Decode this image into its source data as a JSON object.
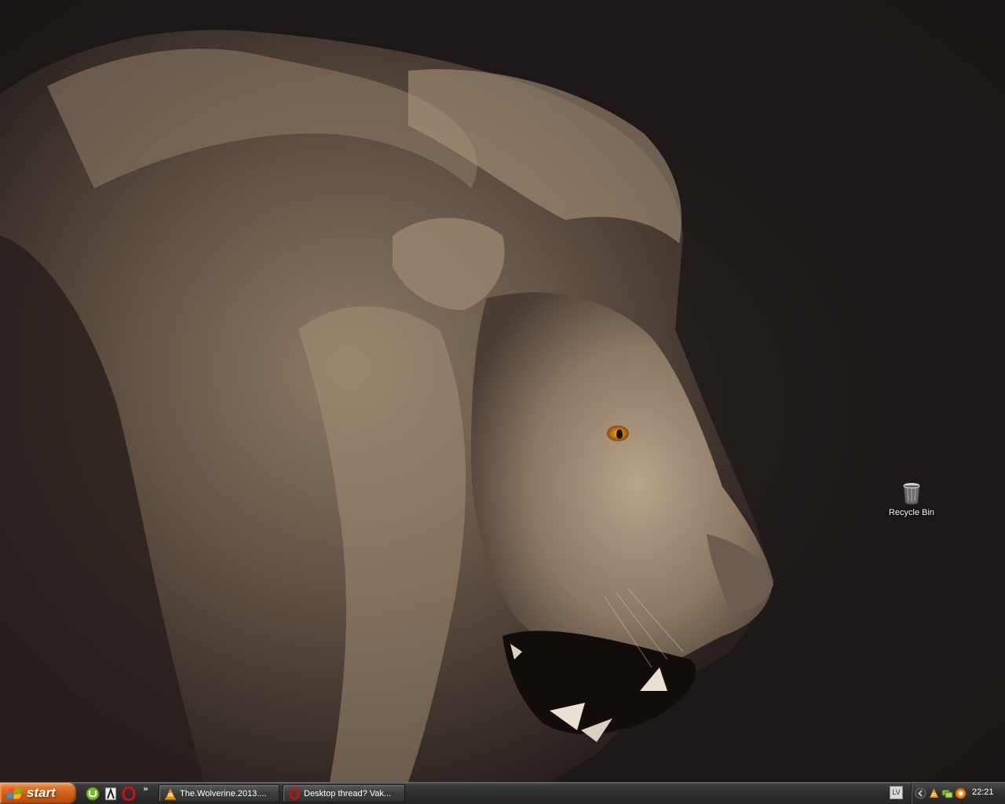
{
  "desktop": {
    "wallpaper": "lion-wallpaper",
    "icons": [
      {
        "label": "Recycle Bin",
        "icon": "recycle-bin-icon"
      }
    ]
  },
  "taskbar": {
    "start_label": "start",
    "quick_launch": [
      {
        "icon": "utorrent-icon"
      },
      {
        "icon": "winamp-icon"
      },
      {
        "icon": "opera-icon"
      }
    ],
    "chevron": "»",
    "tasks": [
      {
        "label": "The.Wolverine.2013....",
        "icon": "vlc-icon"
      },
      {
        "label": "Desktop thread? Vak...",
        "icon": "opera-icon"
      }
    ],
    "language": "LV",
    "tray": {
      "icons": [
        "tray-collapse-icon",
        "vlc-icon",
        "network-icon",
        "avast-icon"
      ],
      "clock": "22:21"
    }
  },
  "colors": {
    "start_button": "#d0641c",
    "taskbar": "#2d2d2d",
    "wallpaper_bg": "#1d1717"
  }
}
